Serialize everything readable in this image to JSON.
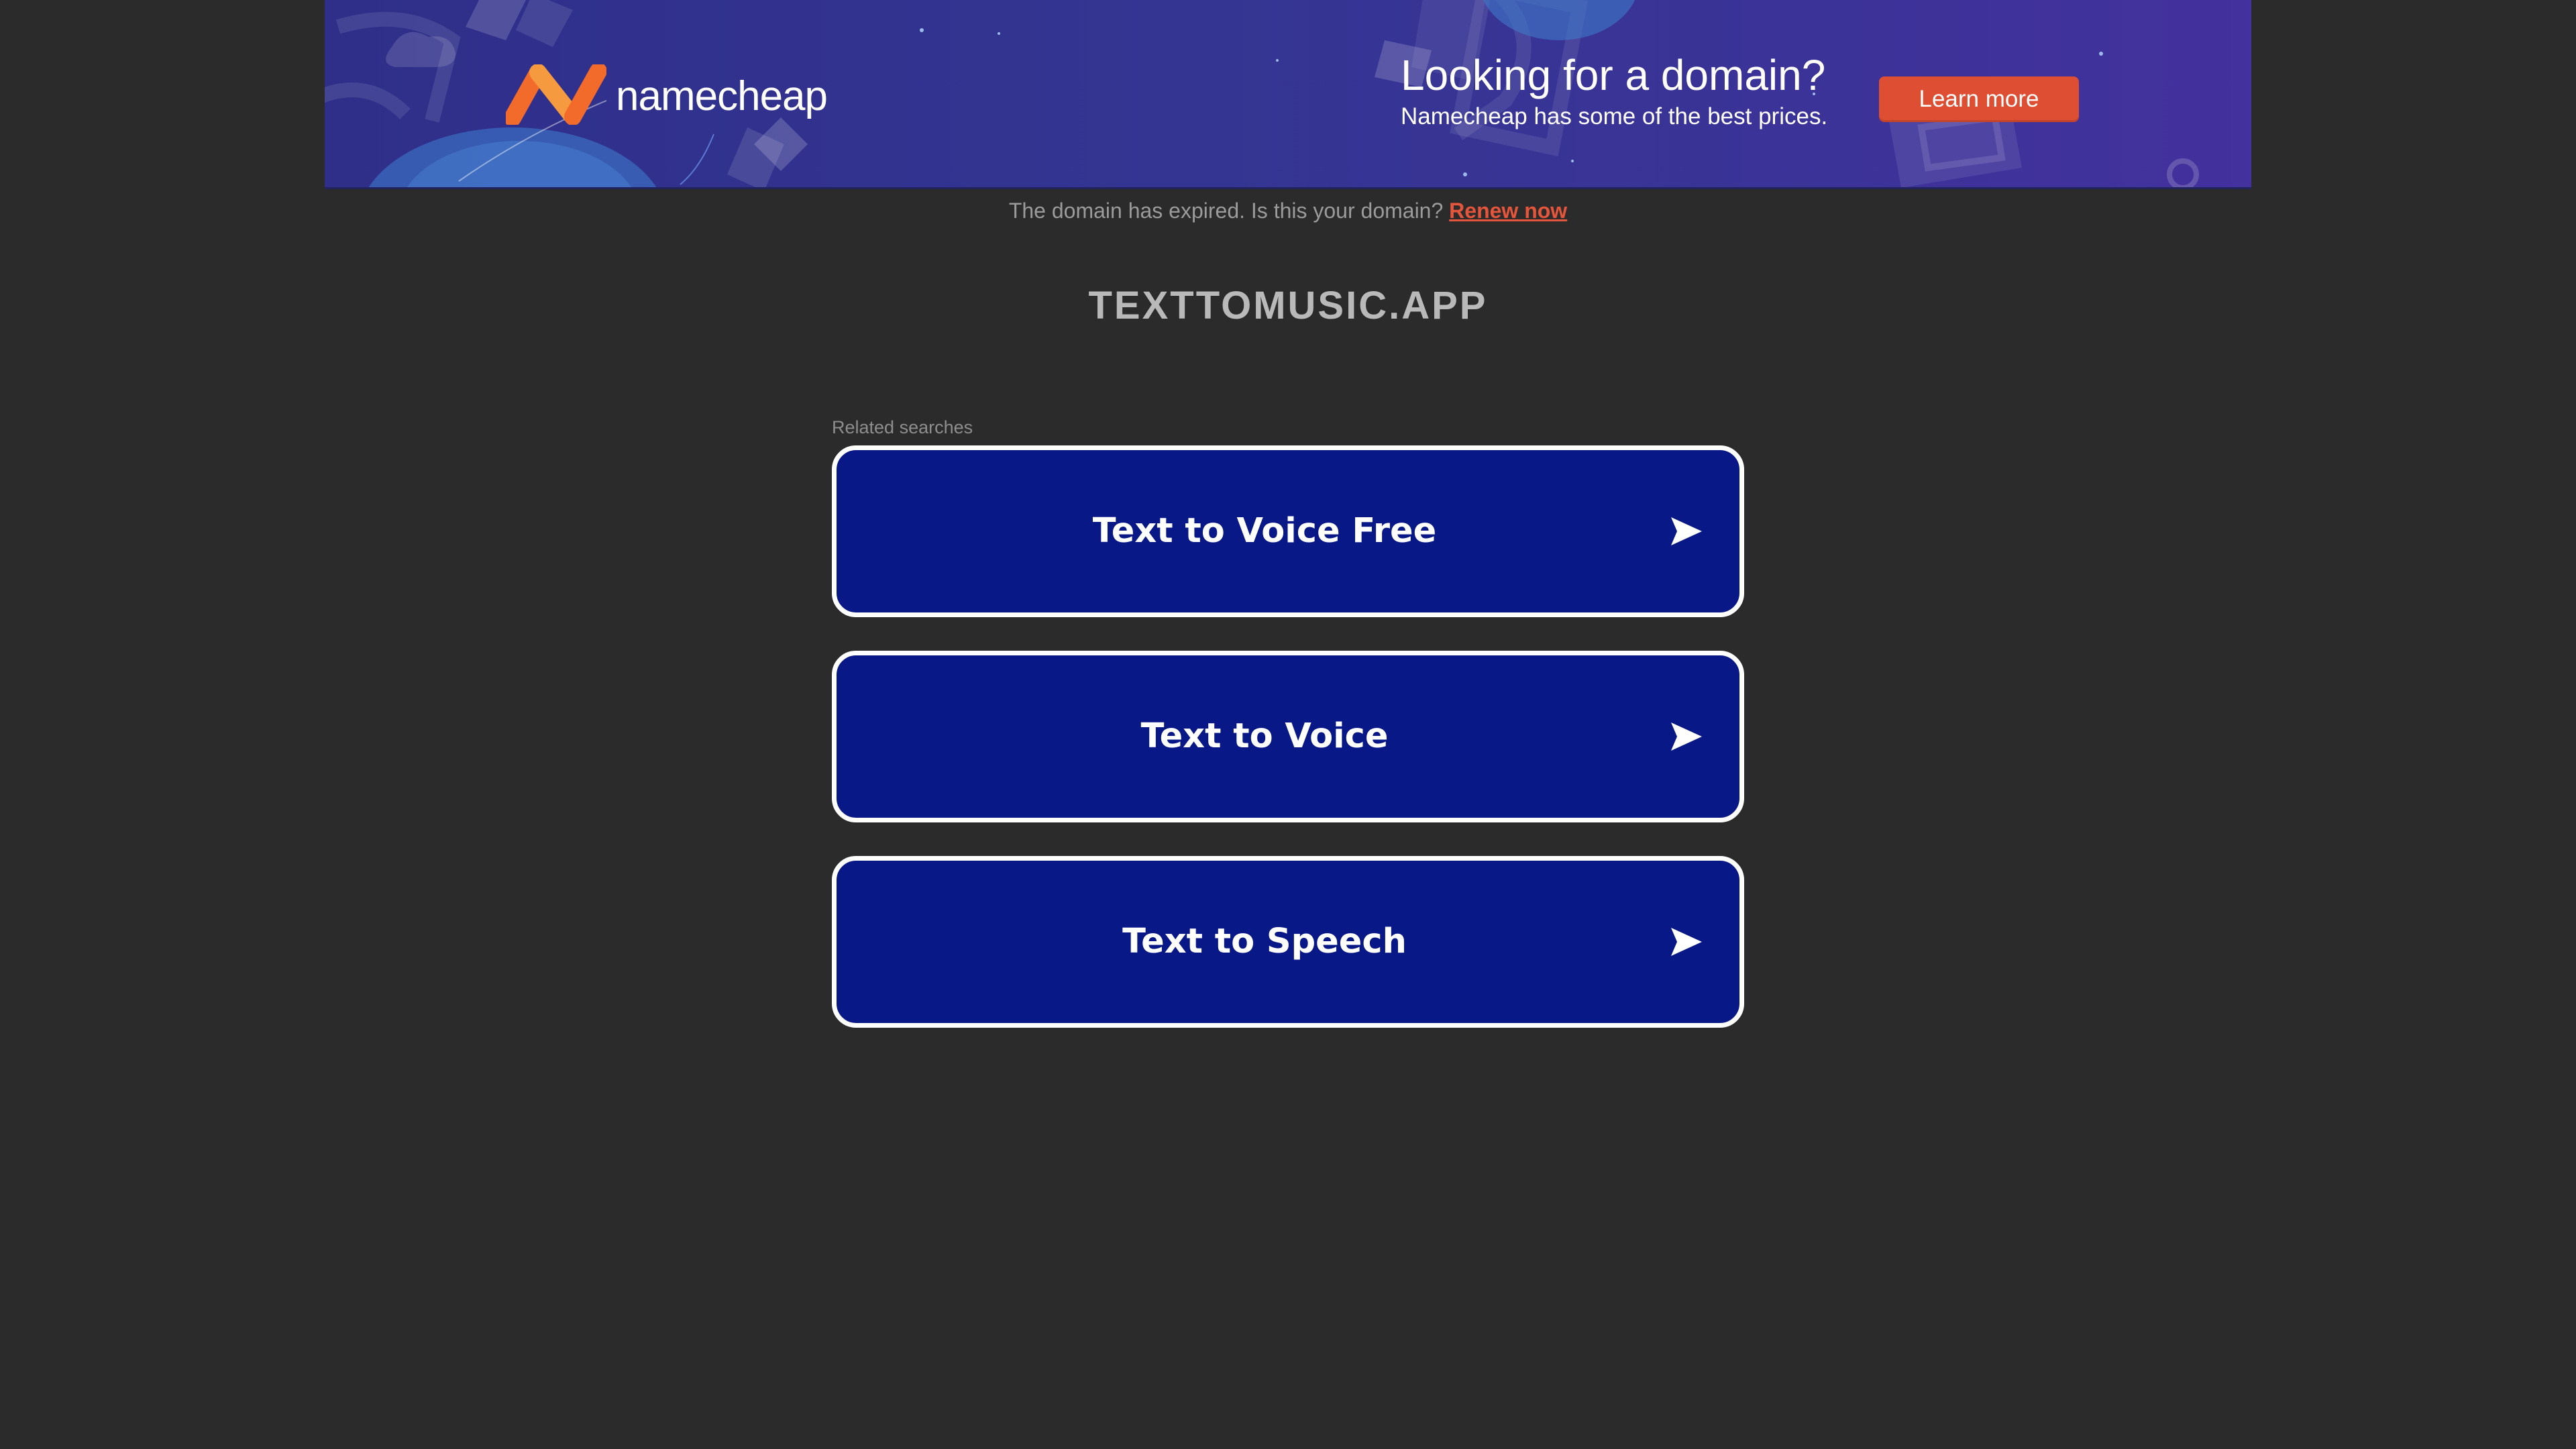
{
  "banner": {
    "brand": "namecheap",
    "title": "Looking for a domain?",
    "subtitle": "Namecheap has some of the best prices.",
    "cta_label": "Learn more",
    "colors": {
      "background": "#343592",
      "cta": "#de4e32",
      "logo_orange": "#f26b2a"
    }
  },
  "notice": {
    "text": "The domain has expired. Is this your domain?",
    "link_label": "Renew now"
  },
  "domain": "TEXTTOMUSIC.APP",
  "related": {
    "label": "Related searches",
    "items": [
      {
        "label": "Text to Voice Free",
        "icon": "arrow-right-icon"
      },
      {
        "label": "Text to Voice",
        "icon": "arrow-right-icon"
      },
      {
        "label": "Text to Speech",
        "icon": "arrow-right-icon"
      }
    ]
  },
  "colors": {
    "page_background": "#2b2b2b",
    "button_background": "#081887",
    "button_border": "#ffffff",
    "link": "#e4553b"
  }
}
